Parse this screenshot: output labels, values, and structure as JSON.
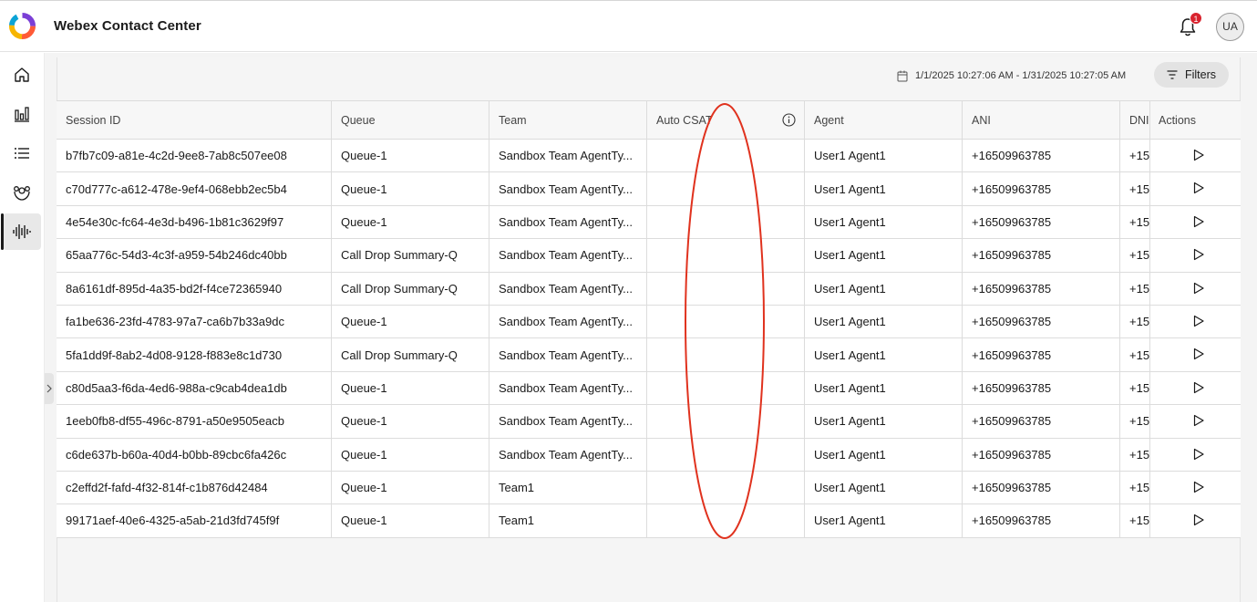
{
  "header": {
    "app_title": "Webex Contact Center",
    "notification_count": "1",
    "user_initials": "UA"
  },
  "sidebar": {
    "items": [
      {
        "icon": "home-icon"
      },
      {
        "icon": "bar-chart-icon"
      },
      {
        "icon": "list-icon"
      },
      {
        "icon": "team-icon"
      },
      {
        "icon": "audio-waveform-icon",
        "active": true
      }
    ]
  },
  "toolbar": {
    "date_range": "1/1/2025 10:27:06 AM - 1/31/2025 10:27:05 AM",
    "filters_label": "Filters"
  },
  "table": {
    "columns": [
      "Session ID",
      "Queue",
      "Team",
      "Auto CSAT",
      "Agent",
      "ANI",
      "DNI",
      "Actions"
    ],
    "rows": [
      {
        "session_id": "b7fb7c09-a81e-4c2d-9ee8-7ab8c507ee08",
        "queue": "Queue-1",
        "team": "Sandbox Team AgentTy...",
        "csat": "",
        "agent": "User1 Agent1",
        "ani": "+16509963785",
        "dni": "+15"
      },
      {
        "session_id": "c70d777c-a612-478e-9ef4-068ebb2ec5b4",
        "queue": "Queue-1",
        "team": "Sandbox Team AgentTy...",
        "csat": "",
        "agent": "User1 Agent1",
        "ani": "+16509963785",
        "dni": "+15"
      },
      {
        "session_id": "4e54e30c-fc64-4e3d-b496-1b81c3629f97",
        "queue": "Queue-1",
        "team": "Sandbox Team AgentTy...",
        "csat": "",
        "agent": "User1 Agent1",
        "ani": "+16509963785",
        "dni": "+15"
      },
      {
        "session_id": "65aa776c-54d3-4c3f-a959-54b246dc40bb",
        "queue": "Call Drop Summary-Q",
        "team": "Sandbox Team AgentTy...",
        "csat": "",
        "agent": "User1 Agent1",
        "ani": "+16509963785",
        "dni": "+15"
      },
      {
        "session_id": "8a6161df-895d-4a35-bd2f-f4ce72365940",
        "queue": "Call Drop Summary-Q",
        "team": "Sandbox Team AgentTy...",
        "csat": "",
        "agent": "User1 Agent1",
        "ani": "+16509963785",
        "dni": "+15"
      },
      {
        "session_id": "fa1be636-23fd-4783-97a7-ca6b7b33a9dc",
        "queue": "Queue-1",
        "team": "Sandbox Team AgentTy...",
        "csat": "",
        "agent": "User1 Agent1",
        "ani": "+16509963785",
        "dni": "+15"
      },
      {
        "session_id": "5fa1dd9f-8ab2-4d08-9128-f883e8c1d730",
        "queue": "Call Drop Summary-Q",
        "team": "Sandbox Team AgentTy...",
        "csat": "",
        "agent": "User1 Agent1",
        "ani": "+16509963785",
        "dni": "+15"
      },
      {
        "session_id": "c80d5aa3-f6da-4ed6-988a-c9cab4dea1db",
        "queue": "Queue-1",
        "team": "Sandbox Team AgentTy...",
        "csat": "",
        "agent": "User1 Agent1",
        "ani": "+16509963785",
        "dni": "+15"
      },
      {
        "session_id": "1eeb0fb8-df55-496c-8791-a50e9505eacb",
        "queue": "Queue-1",
        "team": "Sandbox Team AgentTy...",
        "csat": "",
        "agent": "User1 Agent1",
        "ani": "+16509963785",
        "dni": "+15"
      },
      {
        "session_id": "c6de637b-b60a-40d4-b0bb-89cbc6fa426c",
        "queue": "Queue-1",
        "team": "Sandbox Team AgentTy...",
        "csat": "",
        "agent": "User1 Agent1",
        "ani": "+16509963785",
        "dni": "+15"
      },
      {
        "session_id": "c2effd2f-fafd-4f32-814f-c1b876d42484",
        "queue": "Queue-1",
        "team": "Team1",
        "csat": "",
        "agent": "User1 Agent1",
        "ani": "+16509963785",
        "dni": "+15"
      },
      {
        "session_id": "99171aef-40e6-4325-a5ab-21d3fd745f9f",
        "queue": "Queue-1",
        "team": "Team1",
        "csat": "",
        "agent": "User1 Agent1",
        "ani": "+16509963785",
        "dni": "+15"
      }
    ]
  },
  "colors": {
    "annotation": "#e0321e",
    "badge": "#d9232e"
  }
}
